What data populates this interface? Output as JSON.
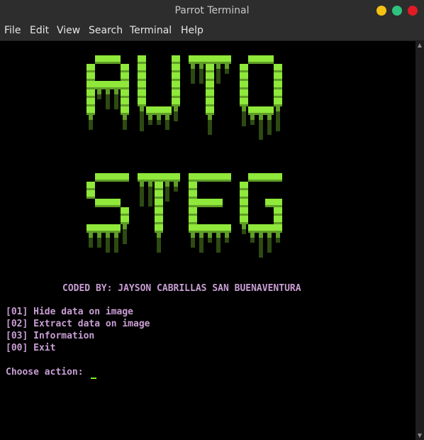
{
  "window": {
    "title": "Parrot Terminal"
  },
  "menu": [
    "File",
    "Edit",
    "View",
    "Search",
    "Terminal",
    "Help"
  ],
  "banner": {
    "line1": "AUTO",
    "line2": "STEG",
    "color_light": "#8fe83a",
    "color_mid": "#5f9e26",
    "color_dark": "#2d4a12"
  },
  "terminal": {
    "credit": "CODED BY: JAYSON CABRILLAS SAN BUENAVENTURA",
    "options": [
      "[01] Hide data on image",
      "[02] Extract data on image",
      "[03] Information",
      "[00] Exit"
    ],
    "prompt": "Choose action: ",
    "text_color": "#c89ed4",
    "cursor_color": "#7ff21c"
  }
}
